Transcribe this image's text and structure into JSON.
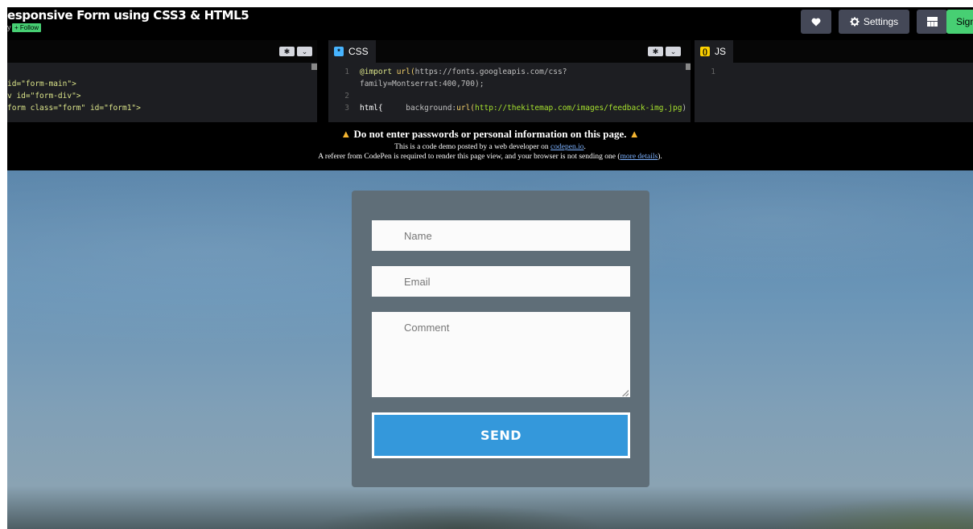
{
  "header": {
    "title": "esponsive Form using CSS3 & HTML5",
    "byline": "y",
    "follow_label": "+ Follow",
    "buttons": {
      "heart_icon": "heart-icon",
      "settings_label": "Settings",
      "layout_icon": "layout-icon",
      "sign_label": "Sign"
    }
  },
  "editors": {
    "html": {
      "lines": [
        "id=\"form-main\">",
        "v id=\"form-div\">",
        "form class=\"form\" id=\"form1\">"
      ]
    },
    "css": {
      "tab_label": "CSS",
      "line_numbers": [
        "1",
        "",
        "2",
        "3"
      ],
      "import_kw": "@import",
      "import_fn": "url(",
      "import_url": "https://fonts.googleapis.com/css?",
      "import_cont": "family=Montserrat:400,700);",
      "html_sel": "html{",
      "bg_prop": "background:",
      "bg_fn": "url(",
      "bg_url": "http://thekitemap.com/images/feedback-img.jpg",
      "bg_close": ")"
    },
    "js": {
      "tab_label": "JS",
      "line_numbers": [
        "1"
      ]
    }
  },
  "warning": {
    "headline": "Do not enter passwords or personal information on this page.",
    "line1_pre": "This is a code demo posted by a web developer on ",
    "line1_link": "codepen.io",
    "line1_post": ".",
    "line2_pre": "A referer from CodePen is required to render this page view, and your browser is not sending one (",
    "line2_link": "more details",
    "line2_post": ")."
  },
  "form": {
    "name_placeholder": "Name",
    "email_placeholder": "Email",
    "comment_placeholder": "Comment",
    "send_label": "SEND"
  },
  "colors": {
    "accent_green": "#47cf73",
    "send_blue": "#3498db",
    "warning_yellow": "#f5b531"
  }
}
